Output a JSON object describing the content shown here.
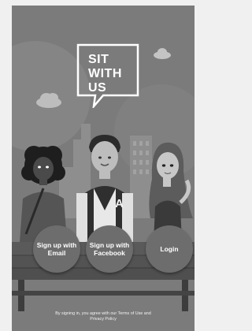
{
  "logo": {
    "lines": [
      "SIT",
      "WITH",
      "US"
    ]
  },
  "buttons": {
    "email": "Sign up with Email",
    "facebook": "Sign up with Facebook",
    "login": "Login"
  },
  "character_badge": "A",
  "legal": {
    "line1": "By signing in, you agree with our Terms of Use and",
    "line2": "Privacy Policy"
  },
  "colors": {
    "background": "#7b7b7b",
    "button": "#6d6d6d",
    "text": "#ffffff"
  }
}
